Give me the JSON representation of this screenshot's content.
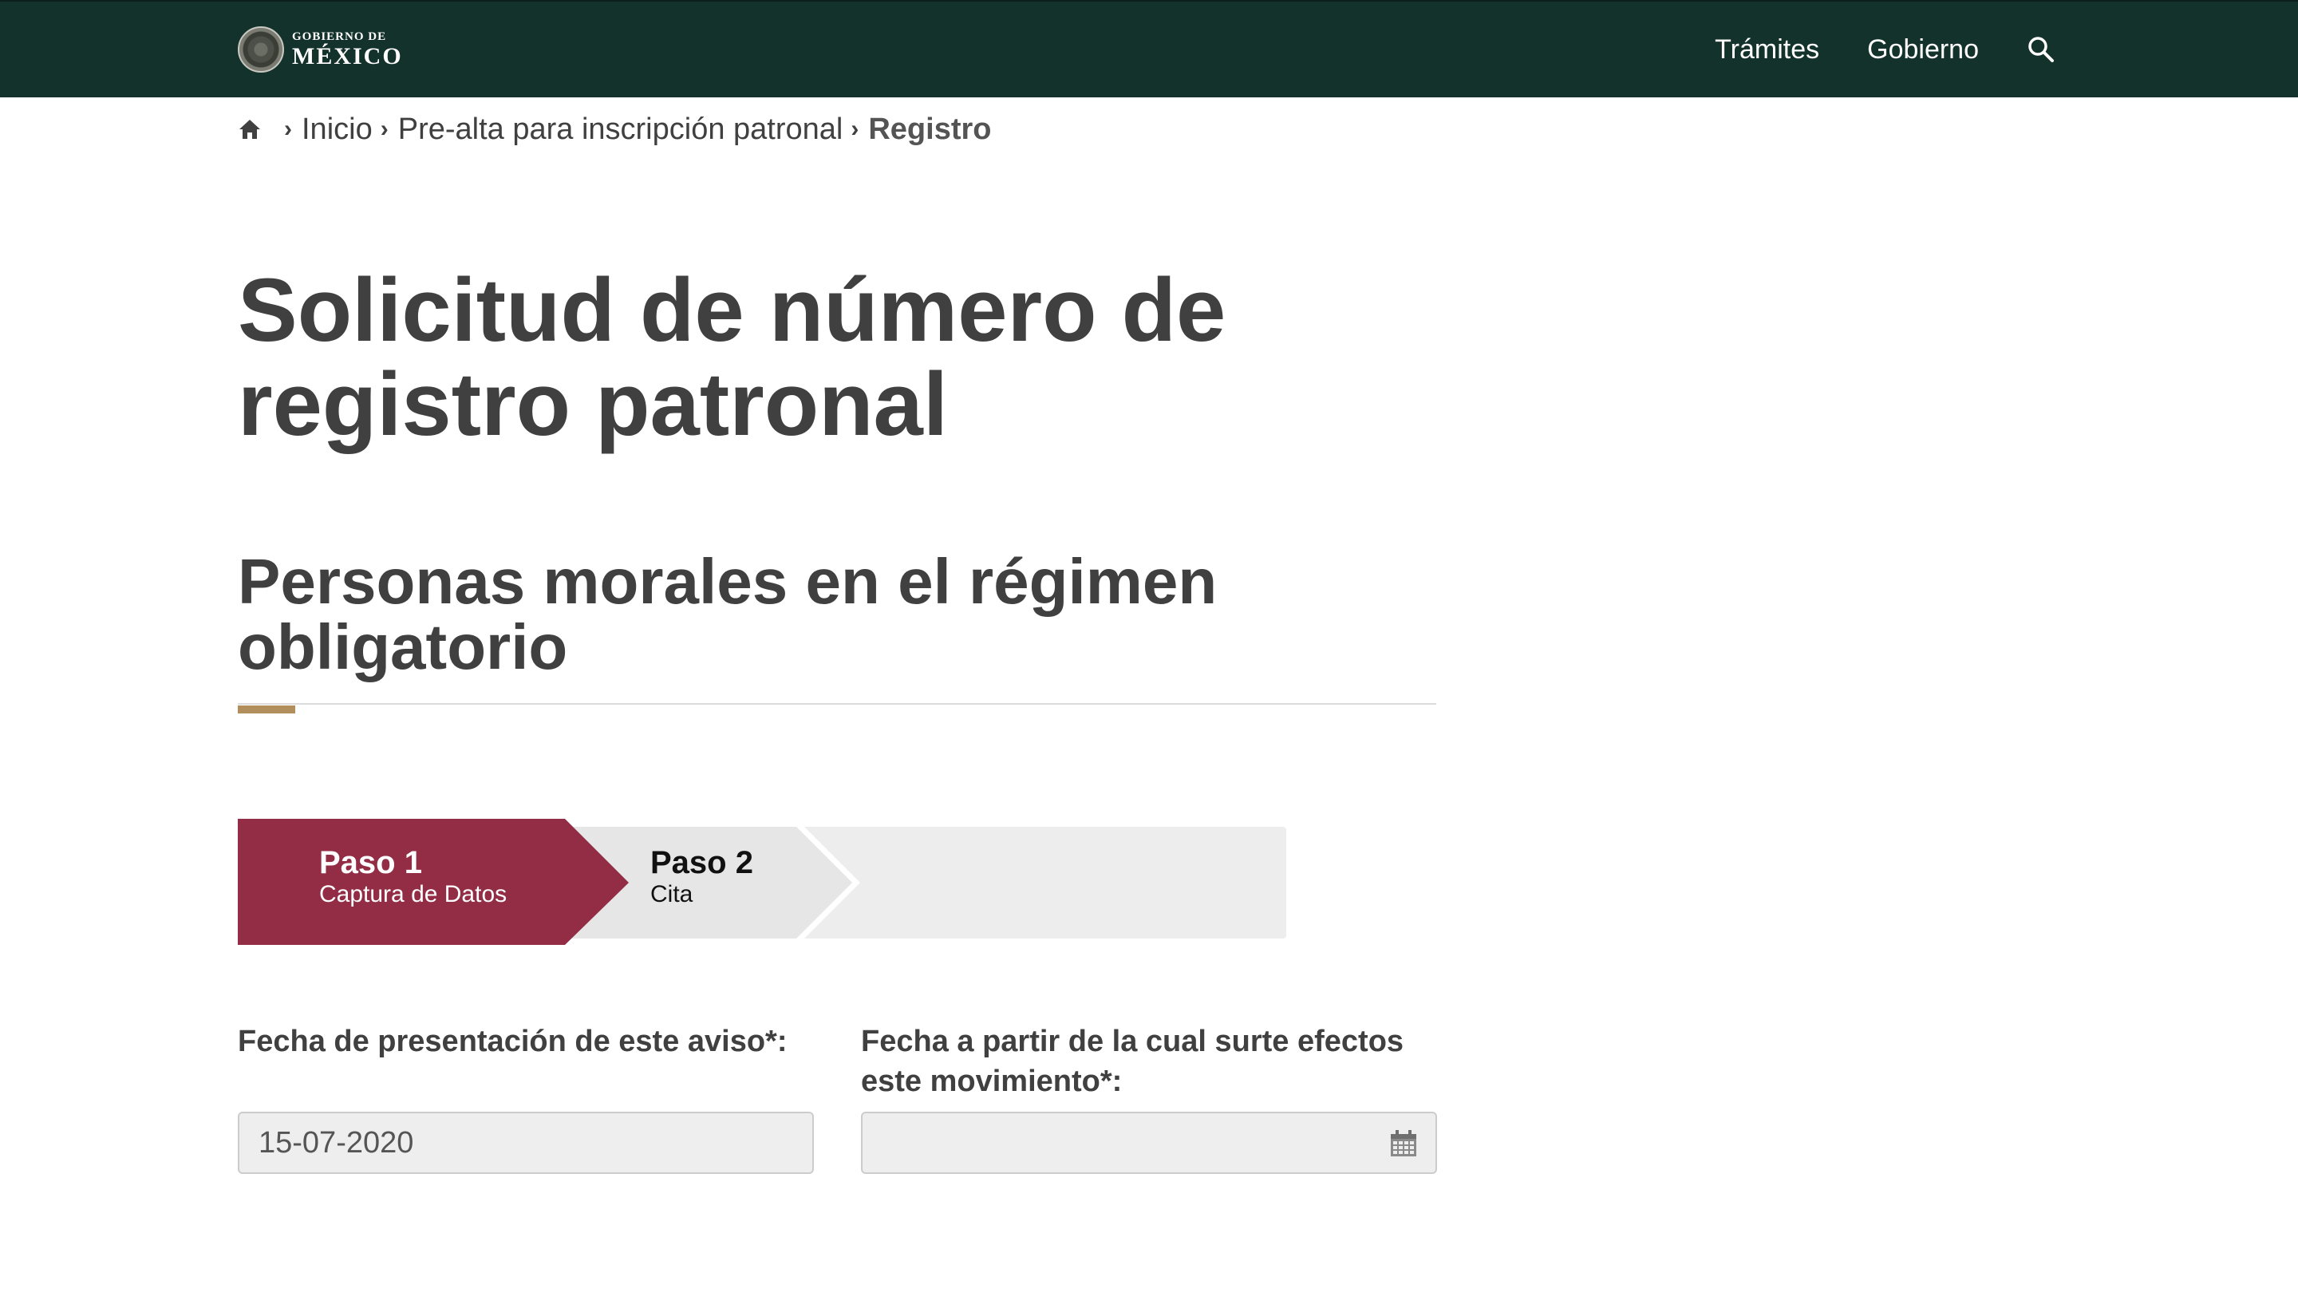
{
  "header": {
    "logo_small": "GOBIERNO DE",
    "logo_big": "MÉXICO",
    "nav": [
      {
        "label": "Trámites"
      },
      {
        "label": "Gobierno"
      }
    ],
    "search_icon": "search-icon"
  },
  "breadcrumb": {
    "home_icon": "home-icon",
    "items": [
      {
        "label": "Inicio"
      },
      {
        "label": "Pre-alta para inscripción patronal"
      },
      {
        "label": "Registro"
      }
    ]
  },
  "main": {
    "title_line1": "Solicitud de número de",
    "title_line2": "registro patronal",
    "section_line1": "Personas morales en el régimen",
    "section_line2": "obligatorio"
  },
  "steps": [
    {
      "title": "Paso 1",
      "subtitle": "Captura de Datos",
      "active": true
    },
    {
      "title": "Paso 2",
      "subtitle": "Cita",
      "active": false
    }
  ],
  "form": {
    "fecha_presentacion": {
      "label": "Fecha de presentación de este aviso*:",
      "value": "15-07-2020"
    },
    "fecha_efectos": {
      "label_line1": "Fecha a partir de la cual surte efectos",
      "label_line2": "este movimiento*:",
      "value": "",
      "icon": "calendar-icon"
    }
  },
  "colors": {
    "navbar": "#13322b",
    "step_active": "#932c45",
    "accent": "#b38e5d",
    "text": "#404041"
  }
}
